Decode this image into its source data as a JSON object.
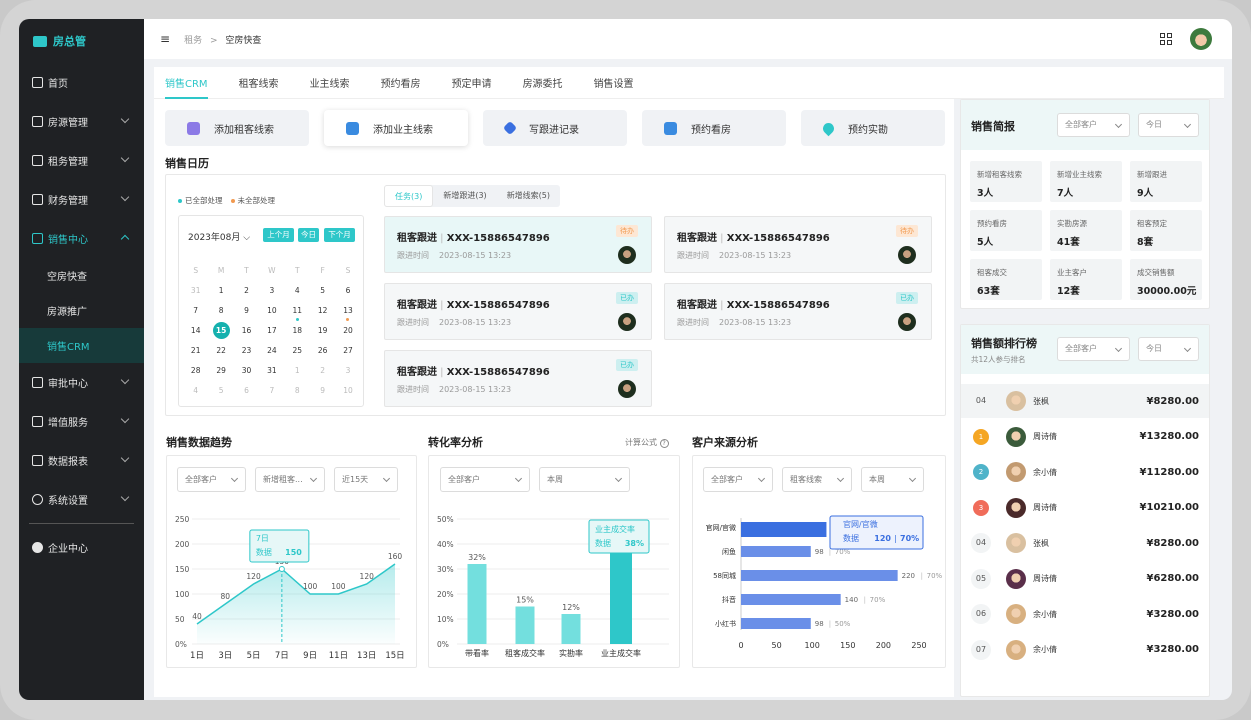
{
  "brand": {
    "name": "房总管"
  },
  "sidebar": {
    "items": [
      {
        "label": "首页"
      },
      {
        "label": "房源管理"
      },
      {
        "label": "租务管理"
      },
      {
        "label": "财务管理"
      },
      {
        "label": "销售中心"
      },
      {
        "label": "审批中心"
      },
      {
        "label": "增值服务"
      },
      {
        "label": "数据报表"
      },
      {
        "label": "系统设置"
      }
    ],
    "sub_items": [
      {
        "label": "空房快查"
      },
      {
        "label": "房源推广"
      },
      {
        "label": "销售CRM"
      }
    ],
    "enterprise": "企业中心"
  },
  "breadcrumb": {
    "parent": "租务",
    "sep": ">",
    "current": "空房快查"
  },
  "tabs": [
    "销售CRM",
    "租客线索",
    "业主线索",
    "预约看房",
    "预定申请",
    "房源委托",
    "销售设置"
  ],
  "quick_actions": [
    "添加租客线索",
    "添加业主线索",
    "写跟进记录",
    "预约看房",
    "预约实勘"
  ],
  "calendar": {
    "title": "销售日历",
    "legend_done": "已全部处理",
    "legend_pending": "未全部处理",
    "month": "2023年08月",
    "prev": "上个月",
    "today": "今日",
    "next": "下个月",
    "weekdays": [
      "S",
      "M",
      "T",
      "W",
      "T",
      "F",
      "S"
    ],
    "weeks": [
      [
        "31",
        "1",
        "2",
        "3",
        "4",
        "5",
        "6"
      ],
      [
        "7",
        "8",
        "9",
        "10",
        "11",
        "12",
        "13"
      ],
      [
        "14",
        "15",
        "16",
        "17",
        "18",
        "19",
        "20"
      ],
      [
        "21",
        "22",
        "23",
        "24",
        "25",
        "26",
        "27"
      ],
      [
        "28",
        "29",
        "30",
        "31",
        "1",
        "2",
        "3"
      ],
      [
        "4",
        "5",
        "6",
        "7",
        "8",
        "9",
        "10"
      ]
    ],
    "today_date": "15"
  },
  "task_tabs": [
    "任务(3)",
    "新增跟进(3)",
    "新增线索(5)"
  ],
  "tasks": [
    {
      "title": "租客跟进",
      "phone": "XXX-15886547896",
      "time_label": "跟进时间",
      "time": "2023-08-15 13:23",
      "status": "待办"
    },
    {
      "title": "租客跟进",
      "phone": "XXX-15886547896",
      "time_label": "跟进时间",
      "time": "2023-08-15 13:23",
      "status": "待办"
    },
    {
      "title": "租客跟进",
      "phone": "XXX-15886547896",
      "time_label": "跟进时间",
      "time": "2023-08-15 13:23",
      "status": "已办"
    },
    {
      "title": "租客跟进",
      "phone": "XXX-15886547896",
      "time_label": "跟进时间",
      "time": "2023-08-15 13:23",
      "status": "已办"
    },
    {
      "title": "租客跟进",
      "phone": "XXX-15886547896",
      "time_label": "跟进时间",
      "time": "2023-08-15 13:23",
      "status": "已办"
    }
  ],
  "trend": {
    "title": "销售数据趋势",
    "filters": [
      "全部客户",
      "新增租客...",
      "近15天"
    ]
  },
  "conversion": {
    "title": "转化率分析",
    "formula": "计算公式",
    "filters": [
      "全部客户",
      "本周"
    ]
  },
  "source": {
    "title": "客户来源分析",
    "filters": [
      "全部客户",
      "租客线索",
      "本周"
    ]
  },
  "chart_data": [
    {
      "type": "line",
      "title": "销售数据趋势",
      "x": [
        "1日",
        "3日",
        "5日",
        "7日",
        "9日",
        "11日",
        "13日",
        "15日"
      ],
      "values": [
        40,
        80,
        120,
        150,
        100,
        100,
        120,
        160
      ],
      "ylim": [
        0,
        250
      ],
      "yticks": [
        "0%",
        "50",
        "100",
        "150",
        "200",
        "250"
      ],
      "tooltip": {
        "label": "7日",
        "series": "数据",
        "value": "150"
      }
    },
    {
      "type": "bar",
      "title": "转化率分析",
      "categories": [
        "带看率",
        "租客成交率",
        "实勘率",
        "业主成交率"
      ],
      "values": [
        32,
        15,
        12,
        38
      ],
      "labels": [
        "32%",
        "15%",
        "12%",
        ""
      ],
      "ylim": [
        0,
        50
      ],
      "yticks": [
        "0%",
        "10%",
        "20%",
        "30%",
        "40%",
        "50%"
      ],
      "tooltip": {
        "label": "业主成交率",
        "series": "数据",
        "value": "38%"
      }
    },
    {
      "type": "bar",
      "title": "客户来源分析",
      "orientation": "horizontal",
      "categories": [
        "官网/官微",
        "闲鱼",
        "58同城",
        "抖音",
        "小红书"
      ],
      "values": [
        120,
        98,
        220,
        140,
        98
      ],
      "rates": [
        "70%",
        "70%",
        "70%",
        "70%",
        "50%"
      ],
      "xlim": [
        0,
        250
      ],
      "xticks": [
        "0",
        "50",
        "100",
        "150",
        "200",
        "250"
      ],
      "tooltip": {
        "label": "官网/官微",
        "series": "数据",
        "value": "120",
        "rate": "70%"
      }
    }
  ],
  "summary": {
    "title": "销售简报",
    "filter1": "全部客户",
    "filter2": "今日",
    "stats": [
      {
        "label": "新增租客线索",
        "value": "3人"
      },
      {
        "label": "新增业主线索",
        "value": "7人"
      },
      {
        "label": "新增跟进",
        "value": "9人"
      },
      {
        "label": "预约看房",
        "value": "5人"
      },
      {
        "label": "实勘房源",
        "value": "41套"
      },
      {
        "label": "租客预定",
        "value": "8套"
      },
      {
        "label": "租客成交",
        "value": "63套"
      },
      {
        "label": "业主客户",
        "value": "12套"
      },
      {
        "label": "成交销售额",
        "value": "30000.00元"
      }
    ]
  },
  "ranking": {
    "title": "销售额排行榜",
    "subtitle": "共12人参与排名",
    "filter1": "全部客户",
    "filter2": "今日",
    "rows": [
      {
        "no": "04",
        "name": "张枫",
        "amount": "¥8280.00"
      },
      {
        "no": "1",
        "name": "周诗倩",
        "amount": "¥13280.00"
      },
      {
        "no": "2",
        "name": "余小倩",
        "amount": "¥11280.00"
      },
      {
        "no": "3",
        "name": "周诗倩",
        "amount": "¥10210.00"
      },
      {
        "no": "04",
        "name": "张枫",
        "amount": "¥8280.00"
      },
      {
        "no": "05",
        "name": "周诗倩",
        "amount": "¥6280.00"
      },
      {
        "no": "06",
        "name": "余小倩",
        "amount": "¥3280.00"
      },
      {
        "no": "07",
        "name": "余小倩",
        "amount": "¥3280.00"
      }
    ]
  },
  "colors": {
    "accent": "#2ec7c9",
    "sidebar": "#1f2124",
    "todo": "#f19a50",
    "bar_blue": "#3a6fe0"
  }
}
